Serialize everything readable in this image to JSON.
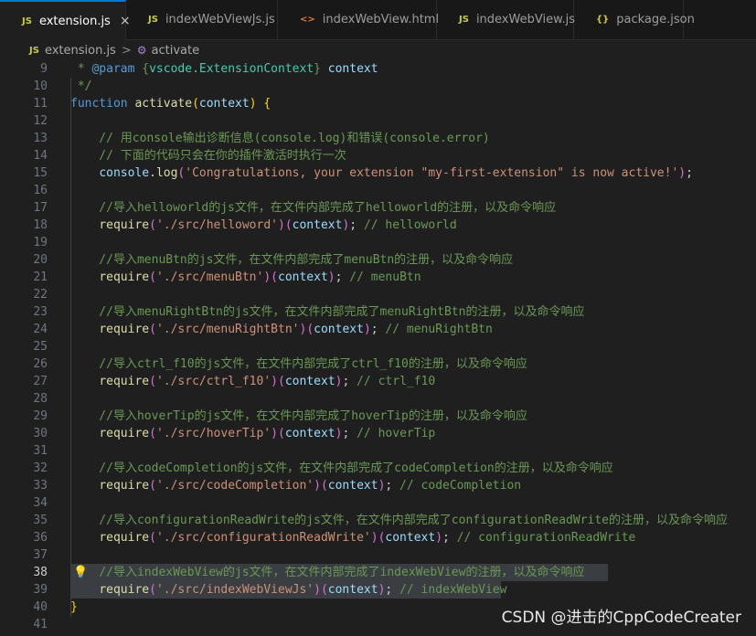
{
  "tabs": [
    {
      "icon": "JS",
      "icon_color": "#cbcb41",
      "label": "extension.js",
      "active": true,
      "close": "×"
    },
    {
      "icon": "JS",
      "icon_color": "#cbcb41",
      "label": "indexWebViewJs.js"
    },
    {
      "icon": "<>",
      "icon_color": "#e37933",
      "label": "indexWebView.html"
    },
    {
      "icon": "JS",
      "icon_color": "#cbcb41",
      "label": "indexWebView.js"
    },
    {
      "icon": "{}",
      "icon_color": "#cbcb41",
      "label": "package.json"
    }
  ],
  "breadcrumb": {
    "file_icon": "JS",
    "file": "extension.js",
    "separator": ">",
    "symbol": "activate"
  },
  "editor": {
    "current_line": 38,
    "lines": [
      {
        "n": "9",
        "tokens": [
          {
            "t": " * ",
            "c": "c-comment"
          },
          {
            "t": "@param",
            "c": "c-tag"
          },
          {
            "t": " {",
            "c": "c-comment"
          },
          {
            "t": "vscode.ExtensionContext",
            "c": "c-type"
          },
          {
            "t": "} ",
            "c": "c-comment"
          },
          {
            "t": "context",
            "c": "c-param"
          }
        ]
      },
      {
        "n": "10",
        "tokens": [
          {
            "t": " */",
            "c": "c-comment"
          }
        ]
      },
      {
        "n": "11",
        "tokens": [
          {
            "t": "function",
            "c": "c-kw"
          },
          {
            "t": " "
          },
          {
            "t": "activate",
            "c": "c-fn"
          },
          {
            "t": "(",
            "c": "c-brace1"
          },
          {
            "t": "context",
            "c": "c-param"
          },
          {
            "t": ")",
            "c": "c-brace1"
          },
          {
            "t": " "
          },
          {
            "t": "{",
            "c": "c-brace1"
          }
        ]
      },
      {
        "n": "12",
        "tokens": []
      },
      {
        "n": "13",
        "tokens": [
          {
            "t": "    // 用console输出诊断信息(console.log)和错误(console.error)",
            "c": "c-comment"
          }
        ]
      },
      {
        "n": "14",
        "tokens": [
          {
            "t": "    // 下面的代码只会在你的插件激活时执行一次",
            "c": "c-comment"
          }
        ]
      },
      {
        "n": "15",
        "tokens": [
          {
            "t": "    "
          },
          {
            "t": "console",
            "c": "c-param"
          },
          {
            "t": "."
          },
          {
            "t": "log",
            "c": "c-fn"
          },
          {
            "t": "(",
            "c": "c-brace2"
          },
          {
            "t": "'Congratulations, your extension \"my-first-extension\" is now active!'",
            "c": "c-str"
          },
          {
            "t": ")",
            "c": "c-brace2"
          },
          {
            "t": ";"
          }
        ]
      },
      {
        "n": "16",
        "tokens": []
      },
      {
        "n": "17",
        "tokens": [
          {
            "t": "    //导入helloworld的js文件，在文件内部完成了helloworld的注册，以及命令响应",
            "c": "c-comment"
          }
        ]
      },
      {
        "n": "18",
        "tokens": [
          {
            "t": "    "
          },
          {
            "t": "require",
            "c": "c-fn"
          },
          {
            "t": "(",
            "c": "c-brace2"
          },
          {
            "t": "'./src/helloword'",
            "c": "c-str"
          },
          {
            "t": ")",
            "c": "c-brace2"
          },
          {
            "t": "(",
            "c": "c-brace2"
          },
          {
            "t": "context",
            "c": "c-param"
          },
          {
            "t": ")",
            "c": "c-brace2"
          },
          {
            "t": "; "
          },
          {
            "t": "// helloworld",
            "c": "c-comment"
          }
        ]
      },
      {
        "n": "19",
        "tokens": []
      },
      {
        "n": "20",
        "tokens": [
          {
            "t": "    //导入menuBtn的js文件，在文件内部完成了menuBtn的注册，以及命令响应",
            "c": "c-comment"
          }
        ]
      },
      {
        "n": "21",
        "tokens": [
          {
            "t": "    "
          },
          {
            "t": "require",
            "c": "c-fn"
          },
          {
            "t": "(",
            "c": "c-brace2"
          },
          {
            "t": "'./src/menuBtn'",
            "c": "c-str"
          },
          {
            "t": ")",
            "c": "c-brace2"
          },
          {
            "t": "(",
            "c": "c-brace2"
          },
          {
            "t": "context",
            "c": "c-param"
          },
          {
            "t": ")",
            "c": "c-brace2"
          },
          {
            "t": "; "
          },
          {
            "t": "// menuBtn",
            "c": "c-comment"
          }
        ]
      },
      {
        "n": "22",
        "tokens": []
      },
      {
        "n": "23",
        "tokens": [
          {
            "t": "    //导入menuRightBtn的js文件，在文件内部完成了menuRightBtn的注册，以及命令响应",
            "c": "c-comment"
          }
        ]
      },
      {
        "n": "24",
        "tokens": [
          {
            "t": "    "
          },
          {
            "t": "require",
            "c": "c-fn"
          },
          {
            "t": "(",
            "c": "c-brace2"
          },
          {
            "t": "'./src/menuRightBtn'",
            "c": "c-str"
          },
          {
            "t": ")",
            "c": "c-brace2"
          },
          {
            "t": "(",
            "c": "c-brace2"
          },
          {
            "t": "context",
            "c": "c-param"
          },
          {
            "t": ")",
            "c": "c-brace2"
          },
          {
            "t": "; "
          },
          {
            "t": "// menuRightBtn",
            "c": "c-comment"
          }
        ]
      },
      {
        "n": "25",
        "tokens": []
      },
      {
        "n": "26",
        "tokens": [
          {
            "t": "    //导入ctrl_f10的js文件，在文件内部完成了ctrl_f10的注册，以及命令响应",
            "c": "c-comment"
          }
        ]
      },
      {
        "n": "27",
        "tokens": [
          {
            "t": "    "
          },
          {
            "t": "require",
            "c": "c-fn"
          },
          {
            "t": "(",
            "c": "c-brace2"
          },
          {
            "t": "'./src/ctrl_f10'",
            "c": "c-str"
          },
          {
            "t": ")",
            "c": "c-brace2"
          },
          {
            "t": "(",
            "c": "c-brace2"
          },
          {
            "t": "context",
            "c": "c-param"
          },
          {
            "t": ")",
            "c": "c-brace2"
          },
          {
            "t": "; "
          },
          {
            "t": "// ctrl_f10",
            "c": "c-comment"
          }
        ]
      },
      {
        "n": "28",
        "tokens": []
      },
      {
        "n": "29",
        "tokens": [
          {
            "t": "    //导入hoverTip的js文件，在文件内部完成了hoverTip的注册，以及命令响应",
            "c": "c-comment"
          }
        ]
      },
      {
        "n": "30",
        "tokens": [
          {
            "t": "    "
          },
          {
            "t": "require",
            "c": "c-fn"
          },
          {
            "t": "(",
            "c": "c-brace2"
          },
          {
            "t": "'./src/hoverTip'",
            "c": "c-str"
          },
          {
            "t": ")",
            "c": "c-brace2"
          },
          {
            "t": "(",
            "c": "c-brace2"
          },
          {
            "t": "context",
            "c": "c-param"
          },
          {
            "t": ")",
            "c": "c-brace2"
          },
          {
            "t": "; "
          },
          {
            "t": "// hoverTip",
            "c": "c-comment"
          }
        ]
      },
      {
        "n": "31",
        "tokens": []
      },
      {
        "n": "32",
        "tokens": [
          {
            "t": "    //导入codeCompletion的js文件，在文件内部完成了codeCompletion的注册，以及命令响应",
            "c": "c-comment"
          }
        ]
      },
      {
        "n": "33",
        "tokens": [
          {
            "t": "    "
          },
          {
            "t": "require",
            "c": "c-fn"
          },
          {
            "t": "(",
            "c": "c-brace2"
          },
          {
            "t": "'./src/codeCompletion'",
            "c": "c-str"
          },
          {
            "t": ")",
            "c": "c-brace2"
          },
          {
            "t": "(",
            "c": "c-brace2"
          },
          {
            "t": "context",
            "c": "c-param"
          },
          {
            "t": ")",
            "c": "c-brace2"
          },
          {
            "t": "; "
          },
          {
            "t": "// codeCompletion",
            "c": "c-comment"
          }
        ]
      },
      {
        "n": "34",
        "tokens": []
      },
      {
        "n": "35",
        "tokens": [
          {
            "t": "    //导入configurationReadWrite的js文件，在文件内部完成了configurationReadWrite的注册，以及命令响应",
            "c": "c-comment"
          }
        ]
      },
      {
        "n": "36",
        "tokens": [
          {
            "t": "    "
          },
          {
            "t": "require",
            "c": "c-fn"
          },
          {
            "t": "(",
            "c": "c-brace2"
          },
          {
            "t": "'./src/configurationReadWrite'",
            "c": "c-str"
          },
          {
            "t": ")",
            "c": "c-brace2"
          },
          {
            "t": "(",
            "c": "c-brace2"
          },
          {
            "t": "context",
            "c": "c-param"
          },
          {
            "t": ")",
            "c": "c-brace2"
          },
          {
            "t": "; "
          },
          {
            "t": "// configurationReadWrite",
            "c": "c-comment"
          }
        ]
      },
      {
        "n": "37",
        "tokens": []
      },
      {
        "n": "38",
        "selected": true,
        "bulb": true,
        "tokens": [
          {
            "t": "    //导入indexWebView的js文件，在文件内部完成了indexWebView的注册，以及命令响应",
            "c": "c-comment"
          }
        ]
      },
      {
        "n": "39",
        "selected": true,
        "tokens": [
          {
            "t": "    "
          },
          {
            "t": "require",
            "c": "c-fn"
          },
          {
            "t": "(",
            "c": "c-brace2"
          },
          {
            "t": "'./src/indexWebViewJs'",
            "c": "c-str"
          },
          {
            "t": ")",
            "c": "c-brace2"
          },
          {
            "t": "(",
            "c": "c-brace2"
          },
          {
            "t": "context",
            "c": "c-param"
          },
          {
            "t": ")",
            "c": "c-brace2"
          },
          {
            "t": "; "
          },
          {
            "t": "// indexWebView",
            "c": "c-comment"
          }
        ]
      },
      {
        "n": "40",
        "tokens": [
          {
            "t": "}",
            "c": "c-brace1"
          }
        ]
      },
      {
        "n": "41",
        "tokens": []
      }
    ]
  },
  "watermark": "CSDN @进击的CppCodeCreater"
}
